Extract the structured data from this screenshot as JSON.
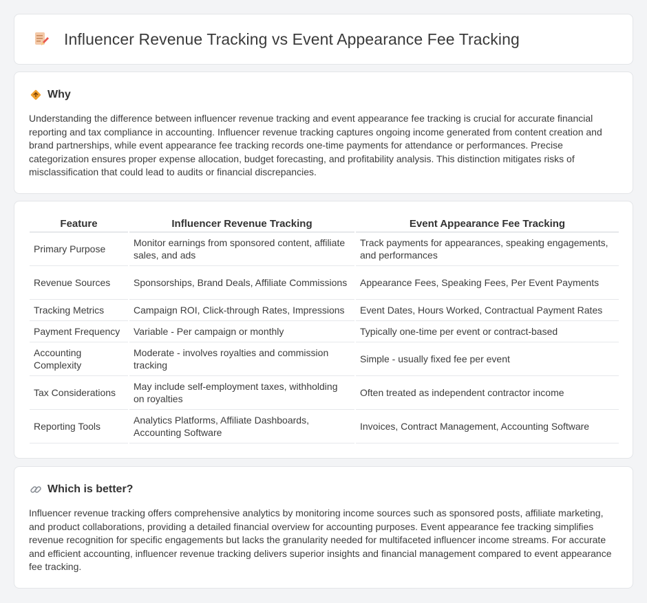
{
  "header": {
    "title": "Influencer Revenue Tracking vs Event Appearance Fee Tracking",
    "icon": "document-pencil-icon"
  },
  "why": {
    "heading": "Why",
    "icon": "diamond-arrows-icon",
    "text": "Understanding the difference between influencer revenue tracking and event appearance fee tracking is crucial for accurate financial reporting and tax compliance in accounting. Influencer revenue tracking captures ongoing income generated from content creation and brand partnerships, while event appearance fee tracking records one-time payments for attendance or performances. Precise categorization ensures proper expense allocation, budget forecasting, and profitability analysis. This distinction mitigates risks of misclassification that could lead to audits or financial discrepancies."
  },
  "table": {
    "headers": [
      "Feature",
      "Influencer Revenue Tracking",
      "Event Appearance Fee Tracking"
    ],
    "rows": [
      [
        "Primary Purpose",
        "Monitor earnings from sponsored content, affiliate sales, and ads",
        "Track payments for appearances, speaking engagements, and performances"
      ],
      [
        "Revenue Sources",
        "Sponsorships, Brand Deals, Affiliate Commissions",
        "Appearance Fees, Speaking Fees, Per Event Payments"
      ],
      [
        "Tracking Metrics",
        "Campaign ROI, Click-through Rates, Impressions",
        "Event Dates, Hours Worked, Contractual Payment Rates"
      ],
      [
        "Payment Frequency",
        "Variable - Per campaign or monthly",
        "Typically one-time per event or contract-based"
      ],
      [
        "Accounting Complexity",
        "Moderate - involves royalties and commission tracking",
        "Simple - usually fixed fee per event"
      ],
      [
        "Tax Considerations",
        "May include self-employment taxes, withholding on royalties",
        "Often treated as independent contractor income"
      ],
      [
        "Reporting Tools",
        "Analytics Platforms, Affiliate Dashboards, Accounting Software",
        "Invoices, Contract Management, Accounting Software"
      ]
    ]
  },
  "better": {
    "heading": "Which is better?",
    "icon": "link-icon",
    "text": "Influencer revenue tracking offers comprehensive analytics by monitoring income sources such as sponsored posts, affiliate marketing, and product collaborations, providing a detailed financial overview for accounting purposes. Event appearance fee tracking simplifies revenue recognition for specific engagements but lacks the granularity needed for multifaceted influencer income streams. For accurate and efficient accounting, influencer revenue tracking delivers superior insights and financial management compared to event appearance fee tracking."
  },
  "colors": {
    "background": "#f3f4f6",
    "card": "#ffffff",
    "icon_orange": "#f0a030",
    "icon_pink": "#e86a7a"
  }
}
